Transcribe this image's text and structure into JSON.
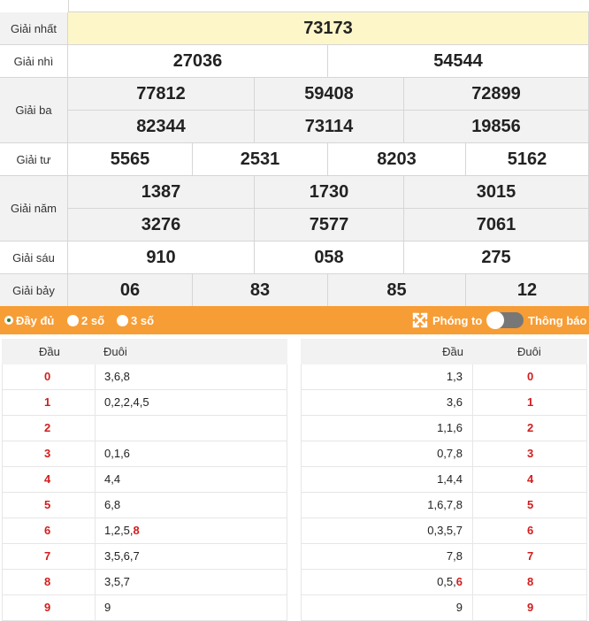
{
  "prizes": {
    "nhat": {
      "label": "Giải nhất",
      "values": [
        "73173"
      ]
    },
    "nhi": {
      "label": "Giải nhì",
      "values": [
        "27036",
        "54544"
      ]
    },
    "ba": {
      "label": "Giải ba",
      "values": [
        "77812",
        "59408",
        "72899",
        "82344",
        "73114",
        "19856"
      ]
    },
    "tu": {
      "label": "Giải tư",
      "values": [
        "5565",
        "2531",
        "8203",
        "5162"
      ]
    },
    "nam": {
      "label": "Giải năm",
      "values": [
        "1387",
        "1730",
        "3015",
        "3276",
        "7577",
        "7061"
      ]
    },
    "sau": {
      "label": "Giải sáu",
      "values": [
        "910",
        "058",
        "275"
      ]
    },
    "bay": {
      "label": "Giải bảy",
      "values": [
        "06",
        "83",
        "85",
        "12"
      ]
    }
  },
  "toolbar": {
    "opt_full": "Đầy đủ",
    "opt_2": "2 số",
    "opt_3": "3 số",
    "zoom": "Phóng to",
    "notify": "Thông báo"
  },
  "colors": {
    "accent": "#f79d35",
    "digit_red": "#d21d1d",
    "highlight": "#fdf6c8"
  },
  "loto_left": {
    "head": "Đầu",
    "tail": "Đuôi",
    "rows": [
      {
        "d": "0",
        "t": "3,6,8"
      },
      {
        "d": "1",
        "t": "0,2,2,4,5"
      },
      {
        "d": "2",
        "t": ""
      },
      {
        "d": "3",
        "t": "0,1,6"
      },
      {
        "d": "4",
        "t": "4,4"
      },
      {
        "d": "5",
        "t": "6,8"
      },
      {
        "d": "6",
        "t": "1,2,5,",
        "t_red": "8"
      },
      {
        "d": "7",
        "t": "3,5,6,7"
      },
      {
        "d": "8",
        "t": "3,5,7"
      },
      {
        "d": "9",
        "t": "9"
      }
    ]
  },
  "loto_right": {
    "head": "Đầu",
    "tail": "Đuôi",
    "rows": [
      {
        "h": "1,3",
        "d": "0"
      },
      {
        "h": "3,6",
        "d": "1"
      },
      {
        "h": "1,1,6",
        "d": "2"
      },
      {
        "h": "0,7,8",
        "d": "3"
      },
      {
        "h": "1,4,4",
        "d": "4"
      },
      {
        "h": "1,6,7,8",
        "d": "5"
      },
      {
        "h": "0,3,5,7",
        "d": "6"
      },
      {
        "h": "7,8",
        "d": "7"
      },
      {
        "h": "0,5,",
        "h_red": "6",
        "d": "8"
      },
      {
        "h": "9",
        "d": "9"
      }
    ]
  }
}
